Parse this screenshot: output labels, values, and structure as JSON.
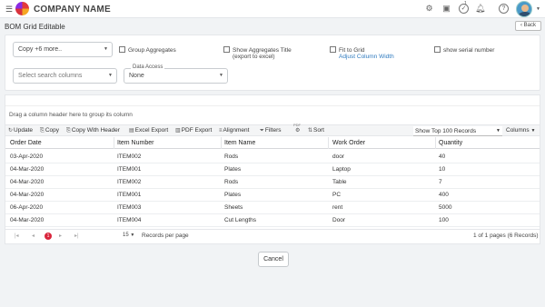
{
  "header": {
    "company_name": "COMPANY NAME",
    "notification_count": "1",
    "icons": [
      "menu-icon",
      "logo",
      "settings-icon",
      "store-icon",
      "tasks-icon",
      "bell-icon",
      "help-icon",
      "avatar"
    ]
  },
  "page": {
    "title": "BOM Grid Editable",
    "back_label": "Back"
  },
  "filters": {
    "copy_select": "Copy  +6 more..",
    "search_columns_placeholder": "Select search columns",
    "data_access_label": "Data Access",
    "data_access_value": "None",
    "group_aggregates": "Group Aggregates",
    "show_aggregates_title": "Show Aggregates Title",
    "show_aggregates_sub": "(export to excel)",
    "fit_to_grid": "Fit to Grid",
    "adjust_column_width": "Adjust Column Width",
    "show_serial_number": "show serial number"
  },
  "grid": {
    "drag_hint": "Drag a column header here to group its column",
    "toolbar": {
      "update": "Update",
      "copy": "Copy",
      "copy_with_header": "Copy With Header",
      "excel_export": "Excel Export",
      "pdf_export": "PDF Export",
      "alignment": "Alignment",
      "filters": "Filters",
      "pdf_small": "PDF",
      "sort": "Sort",
      "show_top": "Show Top 100 Records",
      "columns": "Columns"
    },
    "columns": [
      "Order Date",
      "Item Number",
      "Item Name",
      "Work Order",
      "Quantity"
    ],
    "rows": [
      [
        "03-Apr-2020",
        "ITEM002",
        "Rods",
        "door",
        "40"
      ],
      [
        "04-Mar-2020",
        "ITEM001",
        "Plates",
        "Laptop",
        "10"
      ],
      [
        "04-Mar-2020",
        "ITEM002",
        "Rods",
        "Table",
        "7"
      ],
      [
        "04-Mar-2020",
        "ITEM001",
        "Plates",
        "PC",
        "400"
      ],
      [
        "06-Apr-2020",
        "ITEM003",
        "Sheets",
        "rent",
        "5000"
      ],
      [
        "04-Mar-2020",
        "ITEM004",
        "Cut Lengths",
        "Door",
        "100"
      ]
    ],
    "pager": {
      "current_page": "1",
      "page_size": "15",
      "records_per_page": "Records per page",
      "info": "1 of 1 pages (6 Records)"
    }
  },
  "footer": {
    "cancel_label": "Cancel"
  },
  "colors": {
    "accent": "#d9263d",
    "link": "#2f7bbf"
  }
}
